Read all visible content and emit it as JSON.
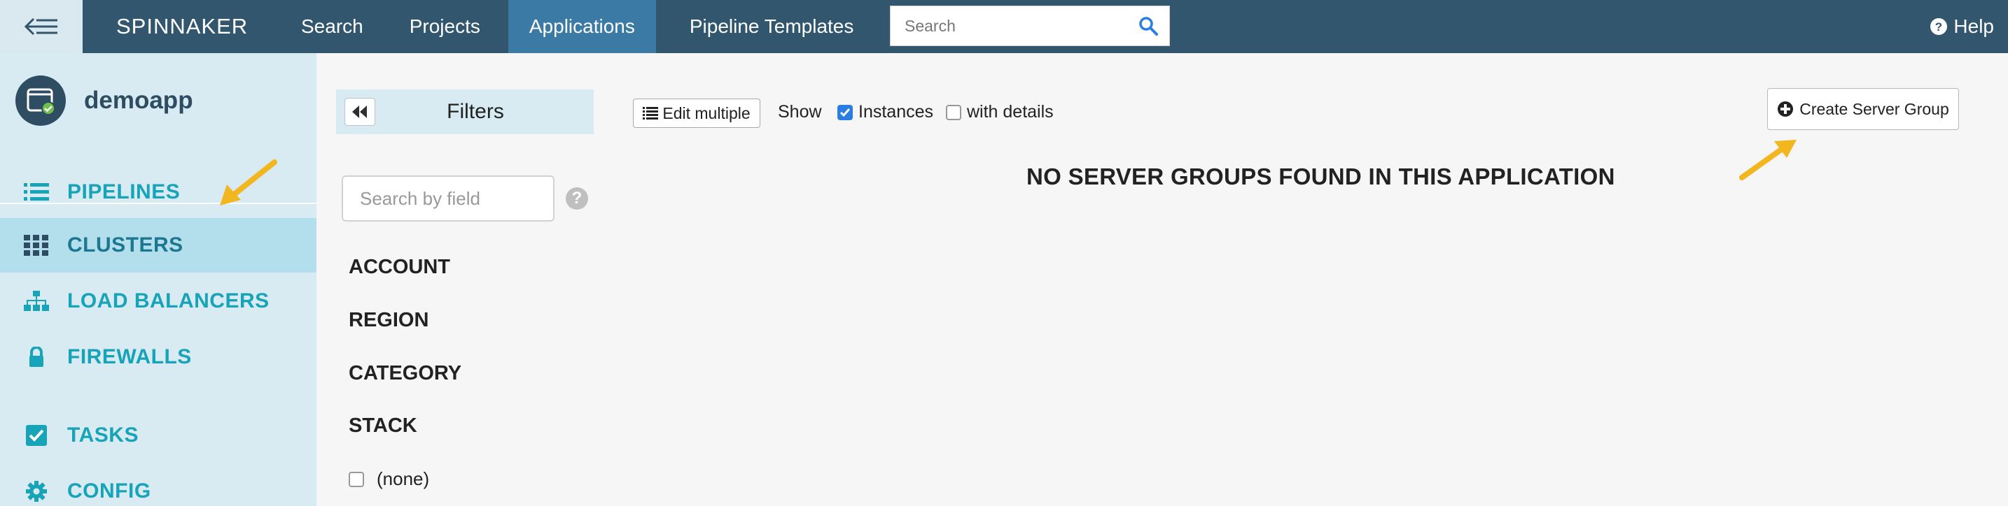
{
  "topnav": {
    "brand": "SPINNAKER",
    "items": [
      {
        "label": "Search",
        "active": false
      },
      {
        "label": "Projects",
        "active": false
      },
      {
        "label": "Applications",
        "active": true
      },
      {
        "label": "Pipeline Templates",
        "active": false
      }
    ],
    "search_placeholder": "Search",
    "help_label": "Help"
  },
  "sidebar": {
    "app_name": "demoapp",
    "items": [
      {
        "label": "PIPELINES",
        "icon": "list-icon",
        "active": false
      },
      {
        "label": "CLUSTERS",
        "icon": "grid-icon",
        "active": true
      },
      {
        "label": "LOAD BALANCERS",
        "icon": "sitemap-icon",
        "active": false
      },
      {
        "label": "FIREWALLS",
        "icon": "lock-icon",
        "active": false
      },
      {
        "label": "TASKS",
        "icon": "checkbox-icon",
        "active": false
      },
      {
        "label": "CONFIG",
        "icon": "gear-icon",
        "active": false
      }
    ]
  },
  "filters": {
    "title": "Filters",
    "search_placeholder": "Search by field",
    "headings": [
      "ACCOUNT",
      "REGION",
      "CATEGORY",
      "STACK"
    ],
    "stack_options": [
      {
        "label": "(none)",
        "checked": false
      }
    ]
  },
  "toolbar": {
    "edit_multiple_label": "Edit multiple",
    "show_label": "Show",
    "instances_label": "Instances",
    "instances_checked": true,
    "details_label": "with details",
    "details_checked": false,
    "create_label": "Create Server Group"
  },
  "main": {
    "empty_message": "NO SERVER GROUPS FOUND IN THIS APPLICATION"
  },
  "colors": {
    "nav_bg": "#31566e",
    "nav_active": "#3b7aa4",
    "sidebar_bg": "#d8eaf2",
    "sidebar_active": "#b3deeb",
    "sidebar_text": "#17a3b8",
    "annotation_arrow": "#f2b61e"
  }
}
